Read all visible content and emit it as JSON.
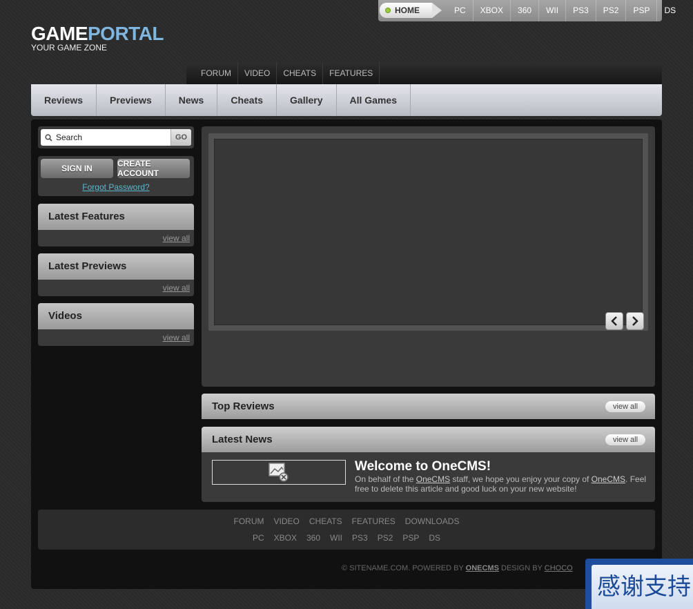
{
  "logo": {
    "part1": "GAME",
    "part2": "PORTAL",
    "tagline": "YOUR GAME ZONE"
  },
  "topnav": {
    "home": "HOME",
    "platforms": [
      "PC",
      "XBOX",
      "360",
      "WII",
      "PS3",
      "PS2",
      "PSP",
      "DS"
    ]
  },
  "subnav": [
    "FORUM",
    "VIDEO",
    "CHEATS",
    "FEATURES"
  ],
  "mainnav": [
    "Reviews",
    "Previews",
    "News",
    "Cheats",
    "Gallery",
    "All Games"
  ],
  "search": {
    "placeholder": "Search",
    "value": "Search",
    "go": "GO"
  },
  "login": {
    "signin": "SIGN IN",
    "create": "CREATE ACCOUNT",
    "forgot": "Forgot Password?"
  },
  "widgets": [
    {
      "title": "Latest Features",
      "view": "view all"
    },
    {
      "title": "Latest Previews",
      "view": "view all"
    },
    {
      "title": "Videos",
      "view": "view all"
    }
  ],
  "slider": {
    "prev": "‹",
    "next": "›"
  },
  "sections": {
    "reviews": {
      "title": "Top Reviews",
      "view": "view all"
    },
    "news": {
      "title": "Latest News",
      "view": "view all",
      "article": {
        "title": "Welcome to OneCMS!",
        "text_a": "On behalf of the ",
        "link1": "OneCMS",
        "text_b": " staff, we hope you enjoy your copy of ",
        "link2": "OneCMS",
        "text_c": ". Feel free to delete this article and good luck on your new website!"
      }
    }
  },
  "footer": {
    "row1": [
      "FORUM",
      "VIDEO",
      "CHEATS",
      "FEATURES",
      "DOWNLOADS"
    ],
    "row2": [
      "PC",
      "XBOX",
      "360",
      "WII",
      "PS3",
      "PS2",
      "PSP",
      "DS"
    ],
    "copy_a": "© SITENAME.COM. POWERED BY ",
    "copy_b": "ONECMS",
    "copy_c": " DESIGN BY ",
    "copy_d": "CHOCO"
  },
  "badge": {
    "text": "感谢支持"
  },
  "colors": {
    "accent": "#7eb6e0",
    "link": "#5ab8d0",
    "home_dot": "#9ccc3c",
    "badge": "#1f4f9c"
  }
}
